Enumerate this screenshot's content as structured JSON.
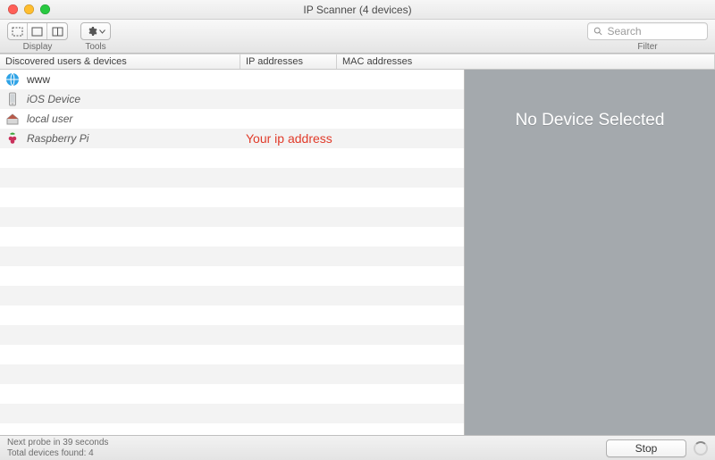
{
  "window": {
    "title": "IP Scanner (4 devices)"
  },
  "toolbar": {
    "display_label": "Display",
    "tools_label": "Tools",
    "filter_label": "Filter",
    "search_placeholder": "Search"
  },
  "columns": {
    "name": "Discovered users & devices",
    "ip": "IP addresses",
    "mac": "MAC addresses"
  },
  "devices": [
    {
      "icon": "globe",
      "name": "www",
      "italic": false,
      "ip": "",
      "mac": ""
    },
    {
      "icon": "phone",
      "name": "iOS Device",
      "italic": true,
      "ip": "",
      "mac": ""
    },
    {
      "icon": "house",
      "name": "local user",
      "italic": true,
      "ip": "",
      "mac": ""
    },
    {
      "icon": "raspberry",
      "name": "Raspberry Pi",
      "italic": true,
      "ip": "Your ip address",
      "ip_highlight": true,
      "mac": ""
    }
  ],
  "blank_row_count": 14,
  "detail_panel": {
    "empty_message": "No Device Selected"
  },
  "footer": {
    "probe_text": "Next probe in 39 seconds",
    "total_text": "Total devices found: 4",
    "stop_label": "Stop"
  }
}
